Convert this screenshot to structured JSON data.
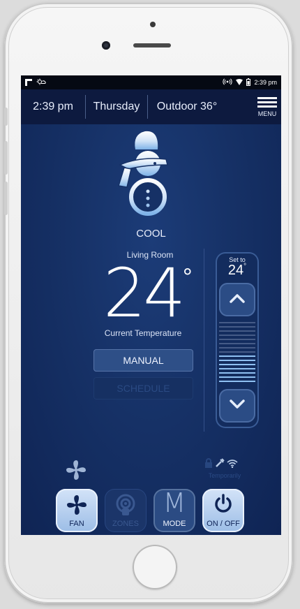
{
  "status_bar": {
    "time": "2:39 pm"
  },
  "header": {
    "time": "2:39 pm",
    "day": "Thursday",
    "outdoor": "Outdoor 36°",
    "menu_label": "MENU"
  },
  "mode": {
    "label": "COOL",
    "icon": "snowman-icon"
  },
  "room": {
    "name": "Living Room",
    "current_temp": "24",
    "degree_symbol": "°",
    "current_label": "Current Temperature"
  },
  "schedule_buttons": {
    "manual": "MANUAL",
    "schedule": "SCHEDULE"
  },
  "setpoint": {
    "label": "Set to",
    "value": "24",
    "degree_symbol": "°",
    "level_fraction": 0.5
  },
  "temporarily_label": "Temporarily",
  "bottom_buttons": {
    "fan": "FAN",
    "zones": "ZONES",
    "mode": "MODE",
    "mode_glyph": "M",
    "power": "ON / OFF"
  },
  "colors": {
    "screen_bg": "#163166",
    "accent_light": "#9cbde6",
    "tick_active": "#8fc0f2",
    "tick_inactive": "#5b6f98"
  }
}
